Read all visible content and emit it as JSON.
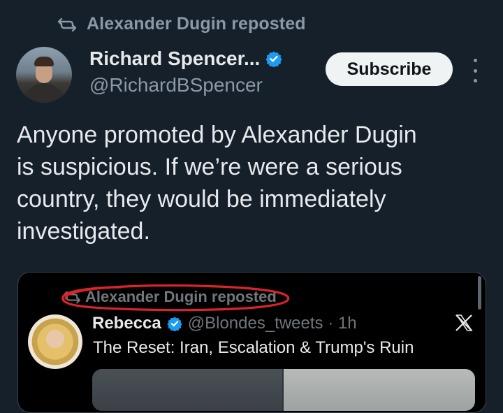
{
  "repost": {
    "label": "Alexander Dugin reposted"
  },
  "author": {
    "name": "Richard Spencer...",
    "handle": "@RichardBSpencer",
    "verified": true
  },
  "subscribe_label": "Subscribe",
  "tweet": {
    "lines": [
      "Anyone promoted by Alexander Dugin",
      "is suspicious. If we’re were a serious",
      "country, they would be immediately",
      "investigated."
    ]
  },
  "quote": {
    "repost_label": "Alexander Dugin reposted",
    "name": "Rebecca",
    "handle_time": "@Blondes_tweets · 1h",
    "text": "The Reset: Iran, Escalation & Trump's Ruin",
    "platform_icon": "x-logo-icon"
  },
  "colors": {
    "background": "#15202b",
    "verified_blue": "#1d9bf0",
    "annotation_red": "#d8252b"
  }
}
